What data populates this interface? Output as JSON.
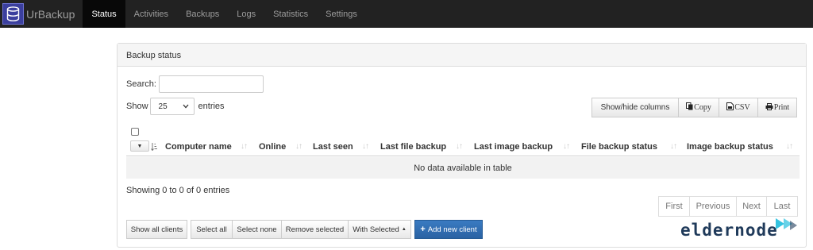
{
  "navbar": {
    "brand": "UrBackup",
    "items": [
      {
        "label": "Status",
        "active": true
      },
      {
        "label": "Activities",
        "active": false
      },
      {
        "label": "Backups",
        "active": false
      },
      {
        "label": "Logs",
        "active": false
      },
      {
        "label": "Statistics",
        "active": false
      },
      {
        "label": "Settings",
        "active": false
      }
    ]
  },
  "panel": {
    "title": "Backup status",
    "search_label": "Search:",
    "search_value": "",
    "length": {
      "prefix": "Show",
      "selected": "25",
      "suffix": "entries"
    },
    "export_buttons": {
      "columns": "Show/hide columns",
      "copy": "Copy",
      "csv": "CSV",
      "print": "Print"
    },
    "table": {
      "headers": [
        "Computer name",
        "Online",
        "Last seen",
        "Last file backup",
        "Last image backup",
        "File backup status",
        "Image backup status"
      ],
      "empty_message": "No data available in table"
    },
    "info": "Showing 0 to 0 of 0 entries",
    "pagination": {
      "first": "First",
      "previous": "Previous",
      "next": "Next",
      "last": "Last"
    },
    "actions": {
      "show_all": "Show all clients",
      "select_all": "Select all",
      "select_none": "Select none",
      "remove_selected": "Remove selected",
      "with_selected": "With Selected",
      "add_client": "Add new client"
    }
  },
  "watermark": {
    "text": "eldernode"
  },
  "colors": {
    "navbar": "#222222",
    "primary": "#2a62a3",
    "brand_logo": "#3b3f9e",
    "watermark": "#1f3a5a",
    "watermark_accent": "#35c3e0"
  }
}
